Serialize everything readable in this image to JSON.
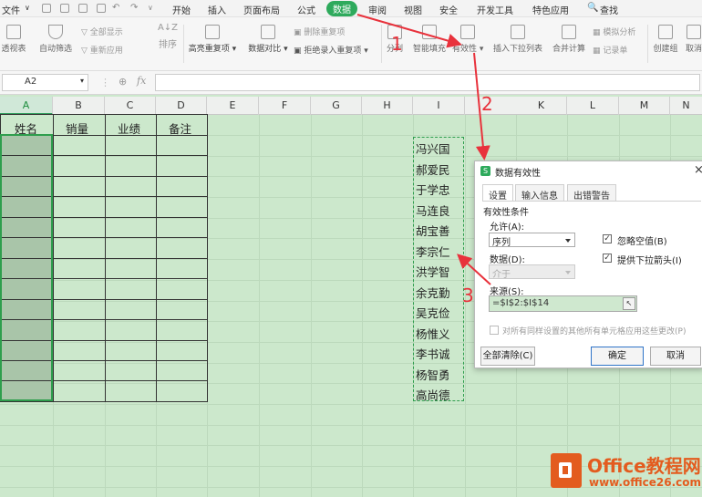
{
  "menubar": {
    "file_label": "文件",
    "tabs": [
      "开始",
      "插入",
      "页面布局",
      "公式",
      "数据",
      "审阅",
      "视图",
      "安全",
      "开发工具",
      "特色应用"
    ],
    "search_label": "查找"
  },
  "ribbon": {
    "pivot": "透视表",
    "autofilter": "自动筛选",
    "show_all": "全部显示",
    "reapply": "重新应用",
    "sort": "排序",
    "highlight_dup": "高亮重复项",
    "data_compare": "数据对比",
    "remove_dup": "删除重复项",
    "reject_dup": "拒绝录入重复项",
    "split": "分列",
    "smart_fill": "智能填充",
    "validation": "有效性",
    "insert_dropdown": "插入下拉列表",
    "consolidate": "合并计算",
    "simulate": "模拟分析",
    "record": "记录单",
    "create_group": "创建组",
    "ungroup": "取消"
  },
  "formula_bar": {
    "cell_ref": "A2",
    "fx": "fx",
    "value": ""
  },
  "grid": {
    "columns": [
      "A",
      "B",
      "C",
      "D",
      "E",
      "F",
      "G",
      "H",
      "I",
      "K",
      "L",
      "M",
      "N"
    ],
    "headers": [
      "姓名",
      "销量",
      "业绩",
      "备注"
    ],
    "names": [
      "冯兴国",
      "郝爱民",
      "于学忠",
      "马连良",
      "胡宝善",
      "李宗仁",
      "洪学智",
      "余克勤",
      "吴克俭",
      "杨惟义",
      "李书诚",
      "杨智勇",
      "高尚德"
    ]
  },
  "annotations": {
    "step1": "1",
    "step2": "2",
    "step3": "3",
    "arrow_color": "#e8323c"
  },
  "dialog": {
    "title": "数据有效性",
    "tabs": [
      "设置",
      "输入信息",
      "出错警告"
    ],
    "section": "有效性条件",
    "allow_label": "允许(A):",
    "allow_value": "序列",
    "data_label": "数据(D):",
    "data_value": "介于",
    "ignore_blank": "忽略空值(B)",
    "dropdown_arrow": "提供下拉箭头(I)",
    "ignore_blank_checked": true,
    "dropdown_arrow_checked": true,
    "source_label": "来源(S):",
    "source_value": "=$I$2:$I$14",
    "apply_all": "对所有同样设置的其他所有单元格应用这些更改(P)",
    "clear_all": "全部清除(C)",
    "ok": "确定",
    "cancel": "取消"
  },
  "watermark": {
    "brand": "Office教程网",
    "url": "www.office26.com",
    "color": "#e35c1f"
  }
}
